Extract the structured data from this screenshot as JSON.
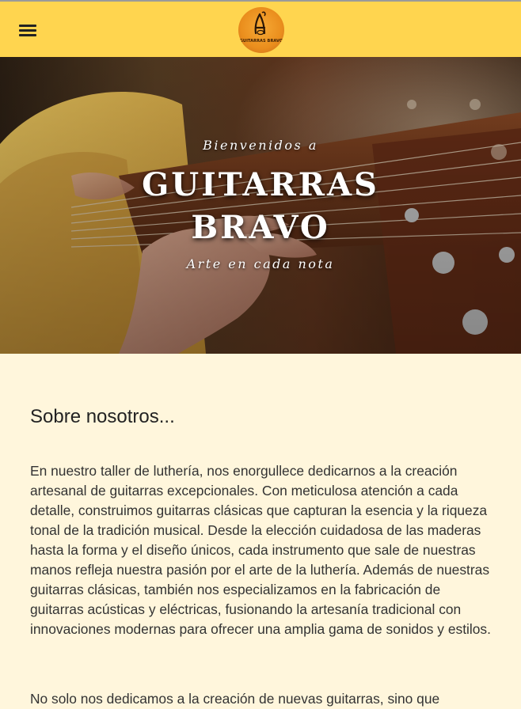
{
  "header": {
    "menu_icon": "hamburger-menu-icon",
    "logo_text": "GUITARRAS BRAVO",
    "logo_icon": "guitar-logo-icon",
    "background_color": "#ffd54f"
  },
  "hero": {
    "welcome": "Bienvenidos a",
    "title_line1": "GUITARRAS",
    "title_line2": "BRAVO",
    "tagline": "Arte en cada nota"
  },
  "about": {
    "title": "Sobre nosotros...",
    "paragraph1": "En nuestro taller de luthería, nos enorgullece dedicarnos a la creación artesanal de guitarras excepcionales. Con meticulosa atención a cada detalle, construimos guitarras clásicas que capturan la esencia y la riqueza tonal de la tradición musical. Desde la elección cuidadosa de las maderas hasta la forma y el diseño únicos, cada instrumento que sale de nuestras manos refleja nuestra pasión por el arte de la luthería. Además de nuestras guitarras clásicas, también nos especializamos en la fabricación de guitarras acústicas y eléctricas, fusionando la artesanía tradicional con innovaciones modernas para ofrecer una amplia gama de sonidos y estilos.",
    "paragraph2": "No solo nos dedicamos a la creación de nuevas guitarras, sino que"
  },
  "colors": {
    "accent": "#ffd54f",
    "page_background": "#fff6dc",
    "text": "#333333"
  }
}
